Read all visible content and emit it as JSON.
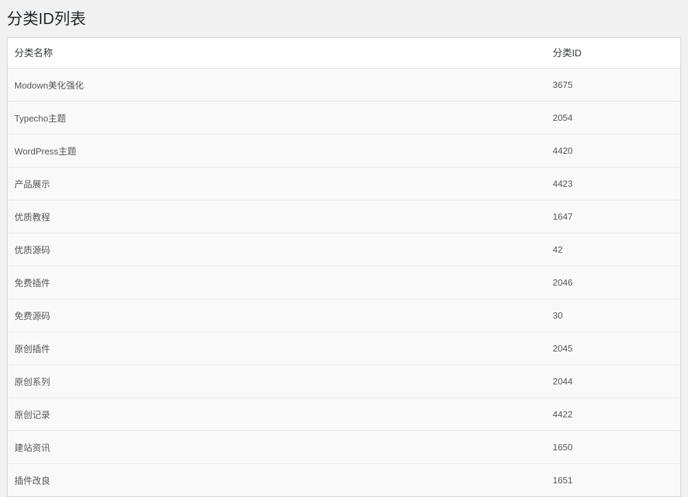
{
  "page": {
    "title": "分类ID列表"
  },
  "table": {
    "headers": {
      "name": "分类名称",
      "id": "分类ID"
    },
    "rows": [
      {
        "name": "Modown美化强化",
        "id": "3675"
      },
      {
        "name": "Typecho主题",
        "id": "2054"
      },
      {
        "name": "WordPress主题",
        "id": "4420"
      },
      {
        "name": "产品展示",
        "id": "4423"
      },
      {
        "name": "优质教程",
        "id": "1647"
      },
      {
        "name": "优质源码",
        "id": "42"
      },
      {
        "name": "免费插件",
        "id": "2046"
      },
      {
        "name": "免费源码",
        "id": "30"
      },
      {
        "name": "原创插件",
        "id": "2045"
      },
      {
        "name": "原创系列",
        "id": "2044"
      },
      {
        "name": "原创记录",
        "id": "4422"
      },
      {
        "name": "建站资讯",
        "id": "1650"
      },
      {
        "name": "插件改良",
        "id": "1651"
      }
    ]
  }
}
